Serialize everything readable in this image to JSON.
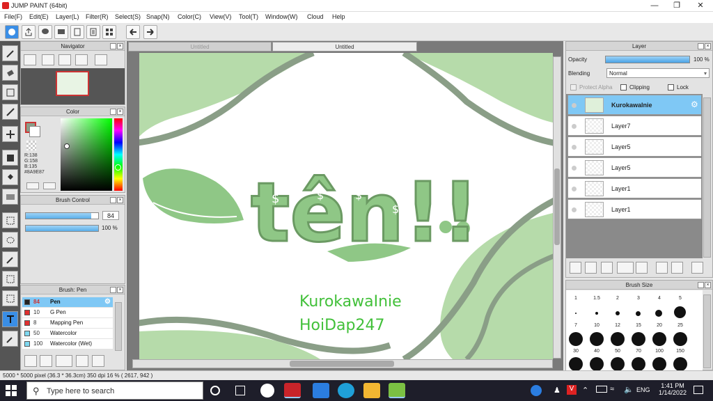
{
  "window": {
    "title": "JUMP PAINT (64bit)"
  },
  "menu": [
    "File(F)",
    "Edit(E)",
    "Layer(L)",
    "Filter(R)",
    "Select(S)",
    "Snap(N)",
    "Color(C)",
    "View(V)",
    "Tool(T)",
    "Window(W)",
    "Cloud",
    "Help"
  ],
  "tabs": [
    "Untitled",
    "Untitled"
  ],
  "navigator": {
    "title": "Navigator"
  },
  "color": {
    "title": "Color",
    "r": "R:138",
    "g": "G:158",
    "b": "B:135",
    "hex": "#8A9E87",
    "swatch": "#8A9E87"
  },
  "brush_control": {
    "title": "Brush Control",
    "size": "84",
    "opacity": "100 %"
  },
  "brush_list": {
    "title": "Brush: Pen",
    "items": [
      {
        "size": "84",
        "name": "Pen",
        "color": "#222222",
        "selected": true
      },
      {
        "size": "10",
        "name": "G Pen",
        "color": "#e03030"
      },
      {
        "size": "8",
        "name": "Mapping Pen",
        "color": "#e03030"
      },
      {
        "size": "50",
        "name": "Watercolor",
        "color": "#7fd8f0"
      },
      {
        "size": "100",
        "name": "Watercolor (Wet)",
        "color": "#7fd8f0"
      }
    ]
  },
  "layer_panel": {
    "title": "Layer",
    "opacity_label": "Opacity",
    "opacity_value": "100 %",
    "blending_label": "Blending",
    "blending_value": "Normal",
    "protect_alpha": "Protect Alpha",
    "clipping": "Clipping",
    "lock": "Lock",
    "layers": [
      "KurokawaInie",
      "Layer7",
      "Layer5",
      "Layer5",
      "Layer1",
      "Layer1"
    ]
  },
  "brush_size": {
    "title": "Brush Size",
    "rows": [
      [
        "1",
        "1.5",
        "2",
        "3",
        "4",
        "5"
      ],
      [
        "7",
        "10",
        "12",
        "15",
        "20",
        "25"
      ],
      [
        "30",
        "40",
        "50",
        "70",
        "100",
        "150"
      ]
    ]
  },
  "artwork": {
    "word": "tên!!",
    "line1": "KurokawaInie",
    "line2": "HoiDap247",
    "currency": "$"
  },
  "status": {
    "text": "5000 * 5000 pixel  (36.3 * 36.3cm)  350 dpi  16 %  ( 2617, 942 )"
  },
  "taskbar": {
    "search_placeholder": "Type here to search",
    "lang": "ENG",
    "time": "1:41 PM",
    "date": "1/14/2022"
  }
}
